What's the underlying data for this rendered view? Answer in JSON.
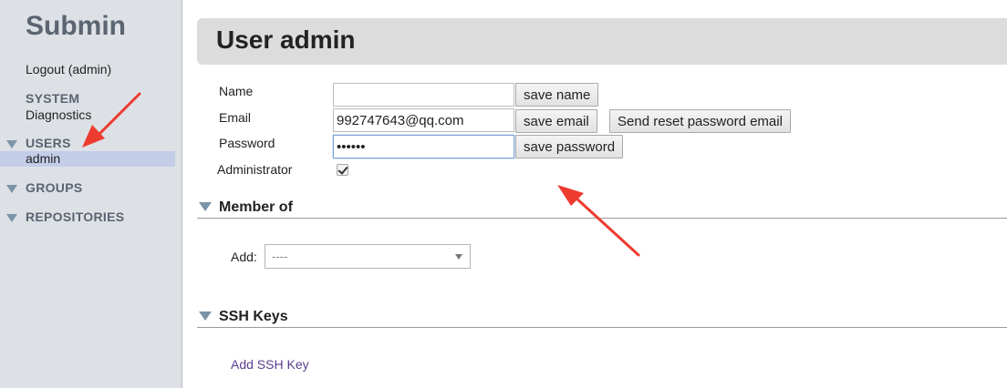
{
  "sidebar": {
    "brand": "Submin",
    "logout": "Logout (admin)",
    "system": {
      "title": "SYSTEM",
      "items": [
        "Diagnostics"
      ]
    },
    "users": {
      "title": "USERS",
      "items": [
        "admin"
      ]
    },
    "groups": {
      "title": "GROUPS"
    },
    "repositories": {
      "title": "REPOSITORIES"
    }
  },
  "main": {
    "title": "User admin",
    "form": {
      "name_label": "Name",
      "name_value": "",
      "save_name": "save name",
      "email_label": "Email",
      "email_value": "992747643@qq.com",
      "save_email": "save email",
      "send_reset": "Send reset password email",
      "password_label": "Password",
      "password_value": "••••••",
      "save_password": "save password",
      "admin_label": "Administrator",
      "admin_checked": true
    },
    "member_of": {
      "title": "Member of",
      "add_label": "Add:",
      "select_value": "----"
    },
    "ssh_keys": {
      "title": "SSH Keys",
      "add_link": "Add SSH Key"
    }
  },
  "colors": {
    "sidebar_bg": "#dde1e6",
    "active_row": "#c3cde8",
    "section_triangle": "#7c94a8",
    "link": "#5a3e8f",
    "annotation_arrow": "#ee3b30"
  }
}
